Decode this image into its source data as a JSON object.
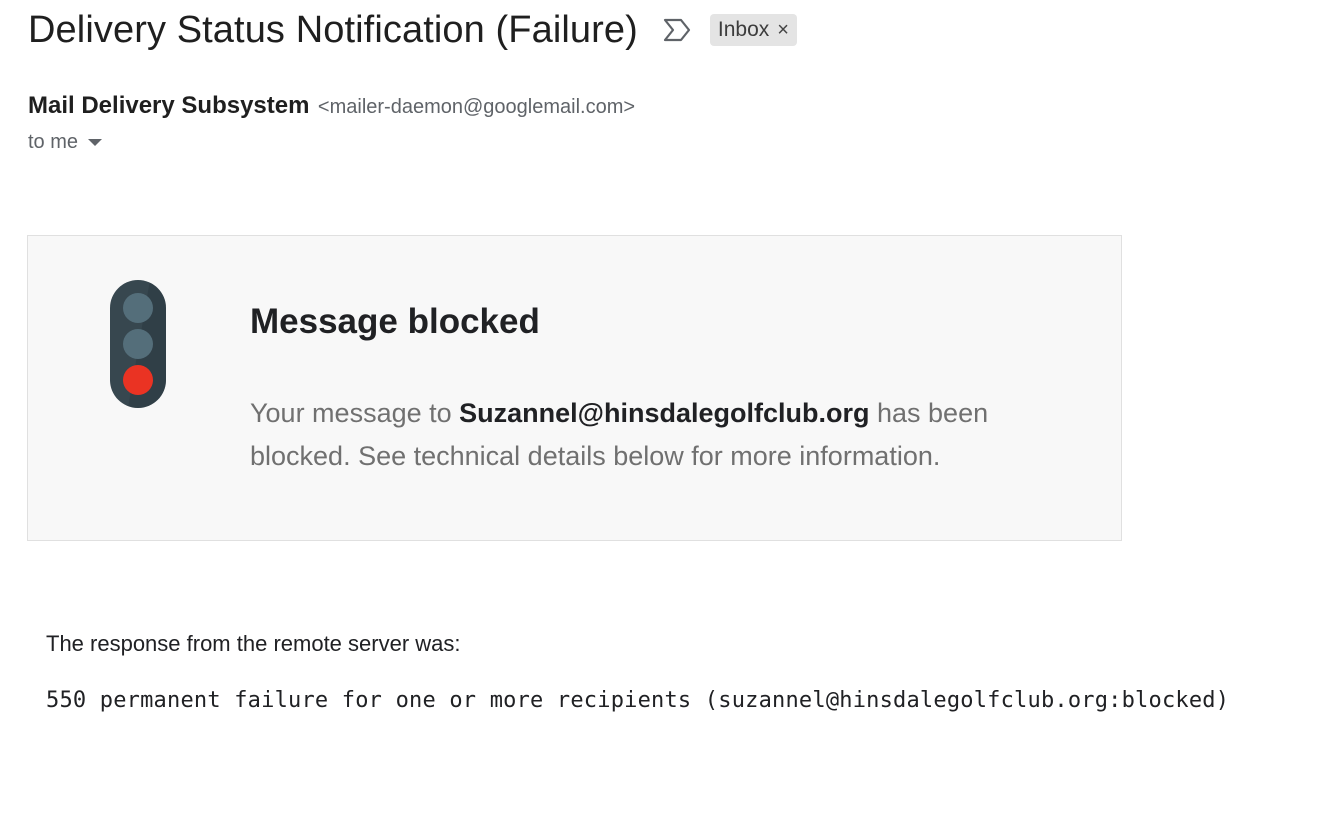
{
  "email": {
    "subject": "Delivery Status Notification (Failure)",
    "label": "Inbox",
    "label_remove": "×",
    "importance_icon": "importance-marker-icon",
    "sender_name": "Mail Delivery Subsystem",
    "sender_email": "<mailer-daemon@googlemail.com>",
    "recipient_text": "to me",
    "recipient_caret_icon": "caret-down-icon"
  },
  "card": {
    "icon": "traffic-light-red-icon",
    "heading": "Message blocked",
    "text_before": "Your message to ",
    "recipient": "Suzannel@hinsdalegolfclub.org",
    "text_after": " has been blocked. See technical details below for more information.",
    "background_color": "#f8f8f8",
    "light_colors": {
      "body": "#37474f",
      "off": "#546e7a",
      "on": "#ea3323"
    }
  },
  "response": {
    "label": "The response from the remote server was:",
    "code": "550 permanent failure for one or more recipients (suzannel@hinsdalegolfclub.org:blocked)"
  }
}
